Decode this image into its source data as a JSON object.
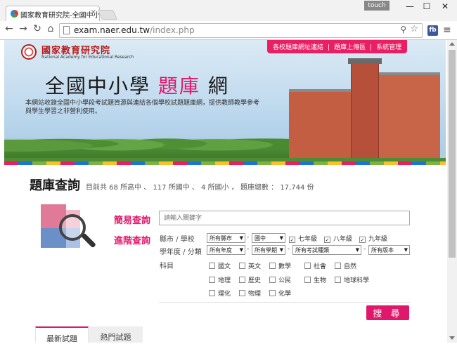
{
  "browser": {
    "tab_title": "國家教育研究院-全國中小",
    "tab_close": "×",
    "touch_label": "touch",
    "url_host": "exam.naer.edu.tw",
    "url_path": "/index.php",
    "ext_label": "fb"
  },
  "header": {
    "logo_cn": "國家教育研究院",
    "logo_en": "National Academy for Educational Research",
    "nav": [
      "各校題庫網址連結",
      "題庫上傳區",
      "系統管理"
    ],
    "title_pre": "全國中小學 ",
    "title_hl": "題庫",
    "title_post": " 網",
    "desc": "本網站收錄全國中小學段考試題資源與連結各個學校試題題庫網，提供教師教學參考與學生學習之非營利使用。"
  },
  "main": {
    "title": "題庫查詢",
    "subtitle": "目前共 68 所高中 、 117 所國中 、 4 所國小 ， 題庫總數 ： 17,744 份",
    "simple_label": "簡易查詢",
    "search_placeholder": "請輸入關鍵字",
    "advanced_label": "進階查詢",
    "row1_label": "縣市 / 學校",
    "row2_label": "學年度 / 分類",
    "row3_label": "科目",
    "county_select": "所有縣市",
    "school_select": "國中",
    "grades": [
      {
        "label": "七年級",
        "checked": true
      },
      {
        "label": "八年級",
        "checked": true
      },
      {
        "label": "九年級",
        "checked": true
      }
    ],
    "year_select": "所有年度",
    "semester_select": "所有學期",
    "examtype_select": "所有考試種類",
    "version_select": "所有版本",
    "subjects": [
      "國文",
      "英文",
      "數學",
      "社會",
      "自然",
      "地理",
      "歷史",
      "公民",
      "生物",
      "地球科學",
      "理化",
      "物理",
      "化學"
    ],
    "search_button": "搜 尋",
    "tabs": [
      "最新試題",
      "熱門試題"
    ]
  },
  "colors": {
    "accent": "#e0186b",
    "tab_bg": "#f2f2f2"
  }
}
